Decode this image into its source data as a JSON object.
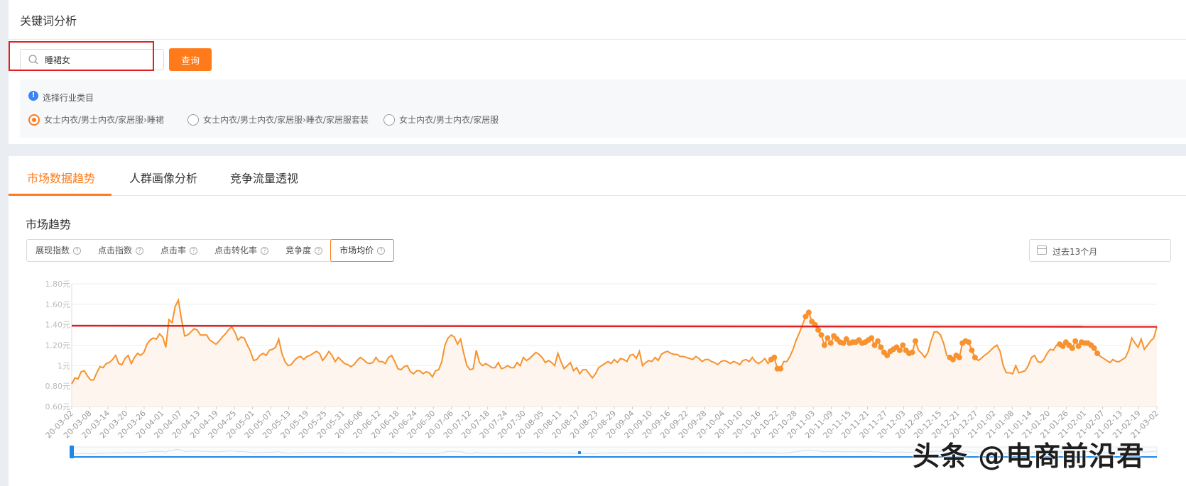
{
  "page_title": "关键词分析",
  "search": {
    "value": "睡裙女",
    "button": "查询"
  },
  "filter": {
    "label": "选择行业类目",
    "options": [
      "女士内衣/男士内衣/家居服›睡裙",
      "女士内衣/男士内衣/家居服›睡衣/家居服套装",
      "女士内衣/男士内衣/家居服"
    ],
    "selected_index": 0
  },
  "tabs": [
    "市场数据趋势",
    "人群画像分析",
    "竞争流量透视"
  ],
  "active_tab_index": 0,
  "section_title": "市场趋势",
  "metrics": [
    "展现指数",
    "点击指数",
    "点击率",
    "点击转化率",
    "竞争度",
    "市场均价"
  ],
  "active_metric_index": 5,
  "date_range": "过去13个月",
  "colors": {
    "accent": "#ff7a1a",
    "line": "#f7922e",
    "reference": "#e02020",
    "slider": "#1e88e5"
  },
  "chart_data": {
    "type": "line",
    "y_tick_labels": [
      "1.80元",
      "1.60元",
      "1.40元",
      "1.20元",
      "1元",
      "0.80元",
      "0.60元"
    ],
    "ylim": [
      0.6,
      1.8
    ],
    "reference_line": {
      "start": 1.39,
      "end": 1.38
    },
    "x_tick_labels": [
      "20-03-02",
      "20-03-08",
      "20-03-14",
      "20-03-20",
      "20-03-26",
      "20-04-01",
      "20-04-07",
      "20-04-13",
      "20-04-19",
      "20-04-25",
      "20-05-01",
      "20-05-07",
      "20-05-13",
      "20-05-19",
      "20-05-25",
      "20-05-31",
      "20-06-06",
      "20-06-12",
      "20-06-18",
      "20-06-24",
      "20-06-30",
      "20-07-06",
      "20-07-12",
      "20-07-18",
      "20-07-24",
      "20-07-30",
      "20-08-05",
      "20-08-11",
      "20-08-17",
      "20-08-23",
      "20-08-29",
      "20-09-04",
      "20-09-10",
      "20-09-16",
      "20-09-22",
      "20-09-28",
      "20-10-04",
      "20-10-10",
      "20-10-16",
      "20-10-22",
      "20-10-28",
      "20-11-03",
      "20-11-09",
      "20-11-15",
      "20-11-21",
      "20-11-27",
      "20-12-03",
      "20-12-09",
      "20-12-15",
      "20-12-21",
      "20-12-27",
      "21-01-02",
      "21-01-08",
      "21-01-14",
      "21-01-20",
      "21-01-26",
      "21-02-01",
      "21-02-07",
      "21-02-13",
      "21-02-19",
      "21-03-02"
    ],
    "series": [
      {
        "values": [
          0.82,
          0.88,
          0.87,
          0.94,
          0.95,
          0.9,
          0.86,
          0.86,
          0.93,
          0.99,
          0.98,
          1.02,
          1.03,
          1.06,
          1.1,
          1.02,
          1.01,
          1.07,
          1.1,
          1.02,
          1.08,
          1.12,
          1.1,
          1.13,
          1.21,
          1.25,
          1.27,
          1.26,
          1.31,
          1.28,
          1.18,
          1.45,
          1.42,
          1.58,
          1.64,
          1.45,
          1.29,
          1.3,
          1.33,
          1.36,
          1.35,
          1.3,
          1.3,
          1.3,
          1.25,
          1.23,
          1.21,
          1.24,
          1.28,
          1.31,
          1.35,
          1.38,
          1.33,
          1.25,
          1.28,
          1.27,
          1.2,
          1.14,
          1.05,
          1.06,
          1.1,
          1.12,
          1.1,
          1.15,
          1.16,
          1.18,
          1.26,
          1.12,
          1.04,
          1.0,
          1.01,
          1.05,
          1.08,
          1.09,
          1.06,
          1.09,
          1.1,
          1.12,
          1.14,
          1.12,
          1.05,
          1.09,
          1.14,
          1.1,
          1.04,
          1.08,
          1.05,
          1.02,
          1.01,
          0.99,
          1.01,
          1.05,
          1.08,
          1.06,
          1.03,
          1.02,
          1.03,
          1.08,
          1.04,
          1.04,
          1.02,
          1.08,
          1.1,
          1.04,
          0.97,
          0.96,
          0.99,
          1.0,
          0.94,
          0.92,
          0.95,
          0.95,
          0.92,
          0.94,
          0.93,
          0.89,
          0.95,
          0.96,
          1.04,
          1.2,
          1.27,
          1.3,
          1.28,
          1.21,
          1.26,
          1.12,
          1.0,
          0.96,
          0.97,
          1.15,
          1.03,
          1.0,
          1.02,
          1.0,
          0.98,
          0.98,
          1.03,
          0.97,
          0.98,
          1.0,
          0.98,
          0.98,
          1.03,
          1.0,
          1.08,
          1.05,
          1.07,
          1.1,
          1.13,
          1.11,
          1.08,
          1.03,
          1.05,
          1.03,
          1.0,
          1.12,
          1.04,
          0.97,
          1.0,
          1.03,
          0.95,
          0.98,
          0.92,
          0.96,
          0.96,
          0.92,
          0.88,
          0.92,
          0.98,
          1.0,
          1.02,
          1.04,
          1.02,
          1.06,
          1.03,
          1.07,
          1.06,
          1.04,
          1.1,
          1.11,
          1.07,
          1.14,
          1.0,
          1.03,
          1.05,
          1.04,
          1.08,
          1.05,
          1.11,
          1.13,
          1.14,
          1.12,
          1.11,
          1.11,
          1.09,
          1.09,
          1.08,
          1.07,
          1.06,
          1.09,
          1.07,
          1.04,
          1.06,
          1.06,
          1.04,
          1.03,
          1.01,
          1.04,
          1.05,
          1.04,
          1.02,
          1.04,
          1.03,
          1.01,
          1.05,
          1.06,
          1.04,
          1.08,
          1.04,
          1.02,
          1.04,
          1.07,
          1.02,
          1.06,
          1.08,
          0.97,
          0.97,
          1.04,
          1.04,
          1.09,
          1.16,
          1.25,
          1.32,
          1.4,
          1.48,
          1.52,
          1.43,
          1.4,
          1.35,
          1.3,
          1.2,
          1.27,
          1.22,
          1.29,
          1.26,
          1.23,
          1.22,
          1.26,
          1.22,
          1.23,
          1.23,
          1.25,
          1.22,
          1.23,
          1.25,
          1.27,
          1.2,
          1.24,
          1.18,
          1.13,
          1.1,
          1.14,
          1.16,
          1.18,
          1.15,
          1.2,
          1.15,
          1.12,
          1.13,
          1.24,
          1.15,
          1.12,
          1.08,
          1.13,
          1.24,
          1.33,
          1.33,
          1.3,
          1.22,
          1.1,
          1.08,
          1.06,
          1.1,
          1.08,
          1.22,
          1.24,
          1.23,
          1.15,
          1.08,
          1.05,
          1.07,
          1.1,
          1.12,
          1.15,
          1.18,
          1.2,
          1.14,
          1.0,
          0.93,
          0.93,
          0.92,
          1.0,
          0.93,
          0.94,
          0.95,
          1.0,
          1.08,
          1.1,
          1.04,
          1.03,
          1.06,
          1.12,
          1.16,
          1.15,
          1.2,
          1.21,
          1.19,
          1.23,
          1.2,
          1.17,
          1.24,
          1.19,
          1.23,
          1.22,
          1.22,
          1.2,
          1.17,
          1.12,
          1.09,
          1.07,
          1.05,
          1.03,
          1.06,
          1.04,
          1.04,
          1.06,
          1.08,
          1.15,
          1.27,
          1.22,
          1.18,
          1.26,
          1.16,
          1.2,
          1.24,
          1.27,
          1.38
        ],
        "markers": [
          [
            223,
            226
          ],
          [
            234,
            269
          ],
          [
            280,
            288
          ],
          [
            315,
            327
          ]
        ]
      }
    ]
  }
}
